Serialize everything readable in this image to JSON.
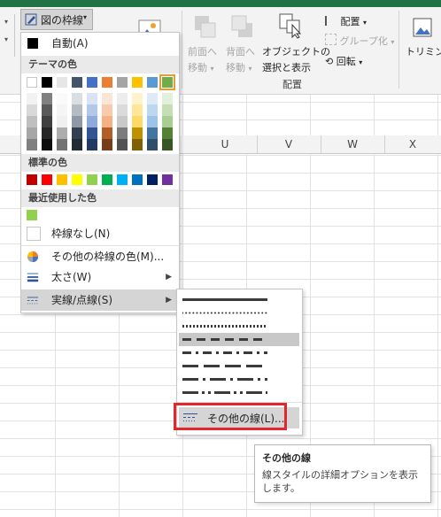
{
  "ribbon": {
    "border_button_label": "図の枠線",
    "bring_forward_l1": "前面へ",
    "bring_forward_l2": "移動",
    "send_backward_l1": "背面へ",
    "send_backward_l2": "移動",
    "selection_pane_l1": "オブジェクトの",
    "selection_pane_l2": "選択と表示",
    "align_label": "配置",
    "group_label": "グループ化",
    "rotate_label": "回転",
    "group_name_arrange": "配置",
    "crop_label": "トリミング"
  },
  "columns": [
    "U",
    "V",
    "W",
    "X"
  ],
  "menu": {
    "automatic_label": "自動(A)",
    "theme_colors_header": "テーマの色",
    "standard_colors_header": "標準の色",
    "recent_colors_header": "最近使用した色",
    "no_outline_label": "枠線なし(N)",
    "more_colors_label": "その他の枠線の色(M)...",
    "weight_label": "太さ(W)",
    "dashes_label": "実線/点線(S)",
    "theme_top_row": [
      "#ffffff",
      "#000000",
      "#e7e6e6",
      "#44546a",
      "#4472c4",
      "#ed7d31",
      "#a5a5a5",
      "#ffc000",
      "#5b9bd5",
      "#70ad47"
    ],
    "standard_colors": [
      "#c00000",
      "#ff0000",
      "#ffc000",
      "#ffff00",
      "#92d050",
      "#00b050",
      "#00b0f0",
      "#0070c0",
      "#002060",
      "#7030a0"
    ],
    "recent_colors": [
      "#92d050"
    ],
    "selected_theme_index": 9
  },
  "submenu": {
    "more_lines_label": "その他の線(L)...",
    "options": [
      "solid",
      "round-dot",
      "square-dot",
      "dash",
      "dash-dot",
      "long-dash",
      "long-dash-dot",
      "long-dash-dot-dot"
    ],
    "selected_index": 3
  },
  "tooltip": {
    "title": "その他の線",
    "body": "線スタイルの詳細オプションを表示します。"
  },
  "accent_color": "#217346",
  "highlight_outline_color": "#e0272b"
}
